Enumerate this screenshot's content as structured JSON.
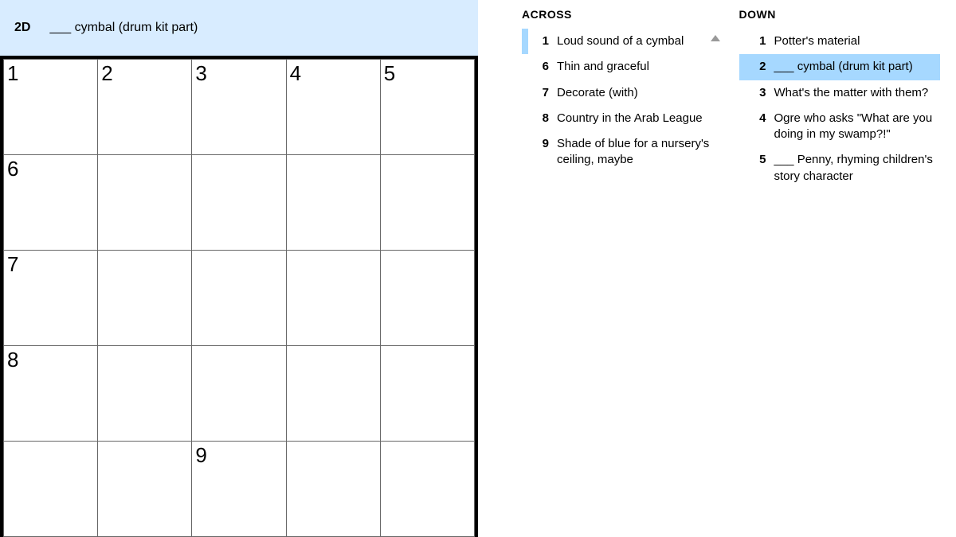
{
  "clueBar": {
    "num": "2D",
    "text": "___ cymbal (drum kit part)"
  },
  "grid": {
    "rows": 5,
    "cols": 5,
    "cells": [
      [
        {
          "num": "1"
        },
        {
          "num": "2",
          "cursor": true
        },
        {
          "num": "3"
        },
        {
          "num": "4"
        },
        {
          "num": "5"
        }
      ],
      [
        {
          "num": "6"
        },
        {
          "hl": true
        },
        {},
        {},
        {}
      ],
      [
        {
          "num": "7"
        },
        {
          "hl": true
        },
        {},
        {},
        {}
      ],
      [
        {
          "num": "8"
        },
        {
          "hl": true
        },
        {},
        {},
        {}
      ],
      [
        {
          "black": true
        },
        {
          "black": true
        },
        {
          "num": "9"
        },
        {},
        {}
      ]
    ]
  },
  "across": {
    "heading": "ACROSS",
    "clues": [
      {
        "n": "1",
        "t": "Loud sound of a cymbal",
        "related": true,
        "arrow": true
      },
      {
        "n": "6",
        "t": "Thin and graceful"
      },
      {
        "n": "7",
        "t": "Decorate (with)"
      },
      {
        "n": "8",
        "t": "Country in the Arab League"
      },
      {
        "n": "9",
        "t": "Shade of blue for a nursery's ceiling, maybe"
      }
    ]
  },
  "down": {
    "heading": "DOWN",
    "clues": [
      {
        "n": "1",
        "t": "Potter's material"
      },
      {
        "n": "2",
        "t": "___ cymbal (drum kit part)",
        "selected": true
      },
      {
        "n": "3",
        "t": "What's the matter with them?"
      },
      {
        "n": "4",
        "t": "Ogre who asks \"What are you doing in my swamp?!\""
      },
      {
        "n": "5",
        "t": "___ Penny, rhyming children's story character"
      }
    ]
  }
}
